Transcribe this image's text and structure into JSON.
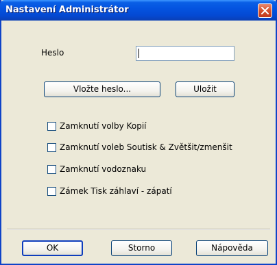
{
  "window": {
    "title": "Nastavení Administrátor"
  },
  "password": {
    "label": "Heslo",
    "value": ""
  },
  "buttons": {
    "enter_password": "Vložte heslo...",
    "save": "Uložit",
    "ok": "OK",
    "cancel": "Storno",
    "help": "Nápověda"
  },
  "checkboxes": [
    {
      "label": "Zamknutí volby Kopií",
      "checked": false
    },
    {
      "label": "Zamknutí voleb Soutisk & Zvětšit/zmenšit",
      "checked": false
    },
    {
      "label": "Zamknutí vodoznaku",
      "checked": false
    },
    {
      "label": "Zámek Tisk záhlaví - zápatí",
      "checked": false
    }
  ],
  "icons": {
    "close": "close-icon"
  },
  "colors": {
    "titlebar": "#0454e0",
    "close": "#d4502c",
    "dialog_bg": "#ece9d8"
  }
}
